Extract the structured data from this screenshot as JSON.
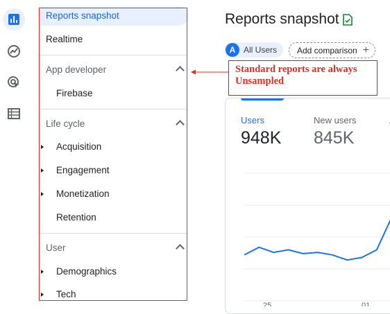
{
  "rail": {
    "items": [
      {
        "icon": "bar-chart-icon",
        "active": true
      },
      {
        "icon": "explore-icon",
        "active": false
      },
      {
        "icon": "advertising-icon",
        "active": false
      },
      {
        "icon": "list-icon",
        "active": false
      }
    ]
  },
  "nav": {
    "reports_snapshot": "Reports snapshot",
    "realtime": "Realtime",
    "app_developer": {
      "title": "App developer",
      "firebase": "Firebase"
    },
    "life_cycle": {
      "title": "Life cycle",
      "acquisition": "Acquisition",
      "engagement": "Engagement",
      "monetization": "Monetization",
      "retention": "Retention"
    },
    "user": {
      "title": "User",
      "demographics": "Demographics",
      "tech": "Tech"
    }
  },
  "header": {
    "title": "Reports snapshot",
    "chip_avatar": "A",
    "chip_label": "All Users",
    "add_comparison": "Add comparison",
    "add_symbol": "+"
  },
  "annotation": {
    "line1": "Standard reports are always",
    "line2": "Unsampled"
  },
  "card": {
    "metrics": [
      {
        "label": "Users",
        "value": "948K",
        "selected": true
      },
      {
        "label": "New users",
        "value": "845K",
        "selected": false
      }
    ],
    "x_ticks": [
      "25",
      "01"
    ]
  },
  "chart_data": {
    "type": "line",
    "series": [
      {
        "values": [
          0.64,
          0.58,
          0.62,
          0.6,
          0.63,
          0.62,
          0.64,
          0.68,
          0.66,
          0.6,
          0.35
        ]
      }
    ]
  },
  "colors": {
    "accent": "#1a73e8",
    "annotation_red": "#d93025",
    "grid": "#e8eaed"
  }
}
